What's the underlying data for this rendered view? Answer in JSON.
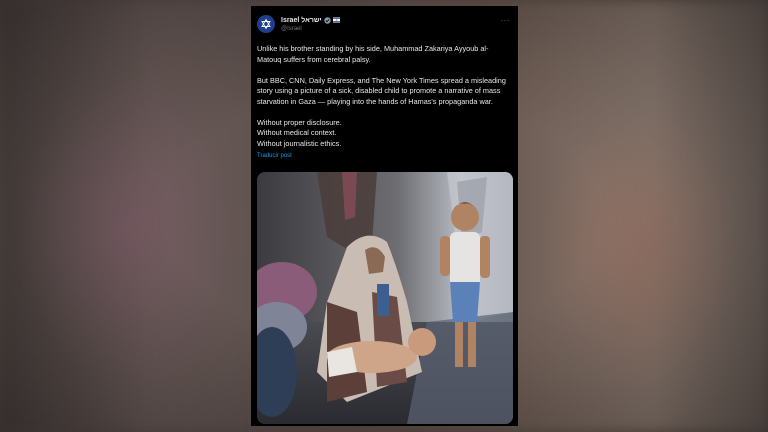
{
  "post": {
    "author": {
      "display_name": "Israel ישראל",
      "handle": "@Israel",
      "avatar_icon": "star-of-david-icon",
      "verified_icon": "verified-badge-icon",
      "flag_icon": "flag-icon"
    },
    "more_label": "···",
    "paragraphs": [
      "Unlike his brother standing by his side, Muhammad Zakariya Ayyoub al-Matouq suffers from cerebral palsy.",
      "But BBC, CNN, Daily Express, and The New York Times spread a misleading story using a picture of a sick, disabled child to promote a narrative of mass starvation in Gaza — playing into the hands of Hamas's propaganda war."
    ],
    "lines": [
      "Without proper disclosure.",
      "Without medical context.",
      "Without journalistic ethics."
    ],
    "translate_label": "Traducir post",
    "media": {
      "type": "photo"
    }
  },
  "colors": {
    "card_bg": "#000000",
    "text": "#e7e9ea",
    "muted": "#71767b",
    "link": "#1d9bf0",
    "avatar": "#1d3f8c"
  }
}
